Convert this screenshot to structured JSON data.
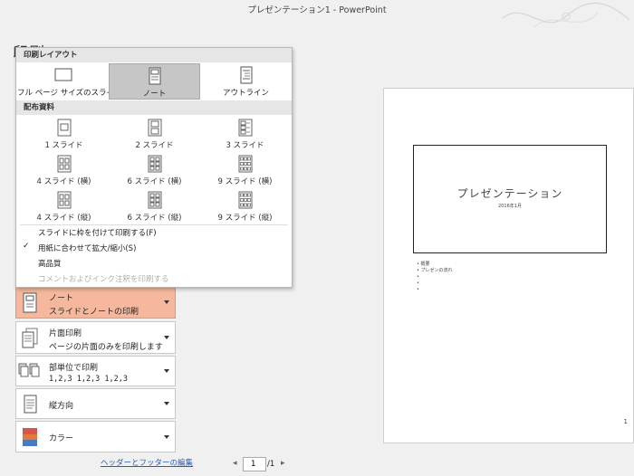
{
  "window": {
    "title": "プレゼンテーション1  -  PowerPoint"
  },
  "backstage": {
    "heading_partial": "印刷"
  },
  "print_layout_panel": {
    "section_print_layout": "印刷レイアウト",
    "layouts": [
      {
        "label": "フル ページ サイズのスライド",
        "icon": "full-page-slide-icon",
        "selected": false
      },
      {
        "label": "ノート",
        "icon": "notes-page-icon",
        "selected": true
      },
      {
        "label": "アウトライン",
        "icon": "outline-icon",
        "selected": false
      }
    ],
    "section_handouts": "配布資料",
    "handouts": [
      {
        "label": "1 スライド",
        "icon": "handout-1-slide-icon"
      },
      {
        "label": "2 スライド",
        "icon": "handout-2-slides-icon"
      },
      {
        "label": "3 スライド",
        "icon": "handout-3-slides-icon"
      },
      {
        "label": "4 スライド (横)",
        "icon": "handout-4-horizontal-icon"
      },
      {
        "label": "6 スライド (横)",
        "icon": "handout-6-horizontal-icon"
      },
      {
        "label": "9 スライド (横)",
        "icon": "handout-9-horizontal-icon"
      },
      {
        "label": "4 スライド (縦)",
        "icon": "handout-4-vertical-icon"
      },
      {
        "label": "6 スライド (縦)",
        "icon": "handout-6-vertical-icon"
      },
      {
        "label": "9 スライド (縦)",
        "icon": "handout-9-vertical-icon"
      }
    ],
    "options": [
      {
        "label": "スライドに枠を付けて印刷する(F)",
        "checked": false,
        "disabled": false
      },
      {
        "label": "用紙に合わせて拡大/縮小(S)",
        "checked": true,
        "disabled": false
      },
      {
        "label": "高品質",
        "checked": false,
        "disabled": false
      },
      {
        "label": "コメントおよびインク注釈を印刷する",
        "checked": false,
        "disabled": true
      }
    ]
  },
  "settings": {
    "layout": {
      "title": "ノート",
      "subtitle": "スライドとノートの印刷",
      "icon": "notes-page-icon"
    },
    "sides": {
      "title": "片面印刷",
      "subtitle": "ページの片面のみを印刷します",
      "icon": "one-sided-print-icon"
    },
    "collation": {
      "title": "部単位で印刷",
      "subtitle": "1,2,3   1,2,3   1,2,3",
      "icon": "collated-icon"
    },
    "orientation": {
      "title": "縦方向",
      "icon": "portrait-orientation-icon"
    },
    "color": {
      "title": "カラー",
      "icon": "color-icon"
    },
    "header_footer_link": "ヘッダーとフッターの編集"
  },
  "preview": {
    "slide_title": "プレゼンテーション",
    "slide_subtitle": "2016年1月",
    "notes": [
      "• 概要",
      "• プレゼンの流れ",
      "•",
      "•",
      "•"
    ],
    "page_number_mark": "1"
  },
  "pager": {
    "current": "1",
    "total": "/1"
  },
  "colors": {
    "active_setting": "#f5b89c",
    "selected_layout": "#c6c6c6",
    "link": "#2a5db0"
  }
}
